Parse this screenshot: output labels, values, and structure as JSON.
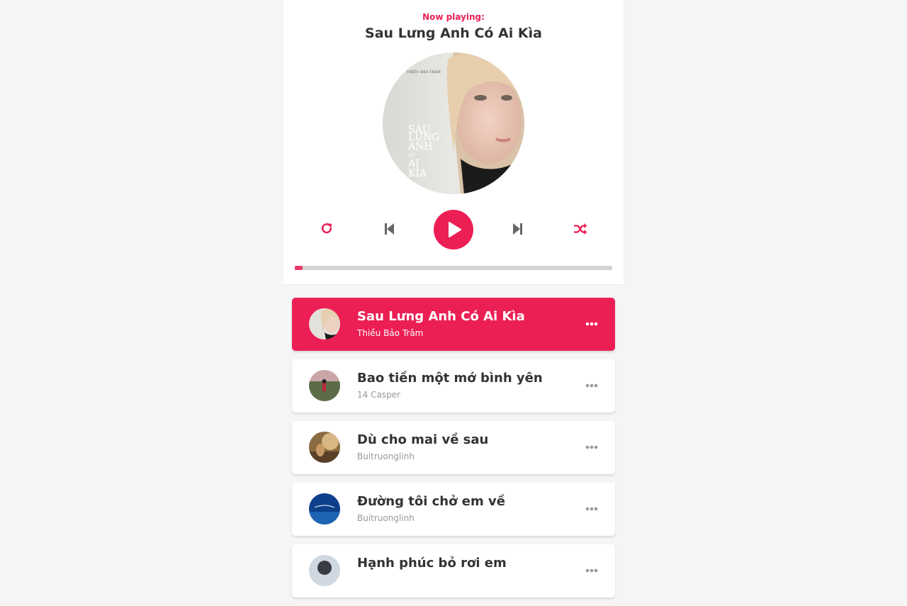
{
  "header": {
    "label": "Now playing:",
    "title": "Sau Lưng Anh Có Ai Kìa"
  },
  "cd": {
    "icon": "album-art-sau-lung-anh-co-ai-kia",
    "artist_small": "THIỀU BẢO TRÂM",
    "cover_lines": [
      "SAU",
      "LƯNG",
      "ANH",
      "có",
      "AI",
      "KÌA"
    ]
  },
  "controls": {
    "repeat_icon": "repeat-icon",
    "prev_icon": "step-backward-icon",
    "play_icon": "play-icon",
    "next_icon": "step-forward-icon",
    "random_icon": "shuffle-icon"
  },
  "progress": {
    "value_percent": 2.5
  },
  "colors": {
    "accent": "#ec1f55",
    "text": "#333333",
    "subtext": "#999999",
    "background": "#f5f5f5",
    "progress_track": "#d3d3d3"
  },
  "playlist": {
    "songs": [
      {
        "title": "Sau Lưng Anh Có Ai Kìa",
        "author": "Thiều Bảo Trâm",
        "active": true
      },
      {
        "title": "Bao tiền một mớ bình yên",
        "author": "14 Casper",
        "active": false
      },
      {
        "title": "Dù cho mai về sau",
        "author": "Buitruonglinh",
        "active": false
      },
      {
        "title": "Đường tôi chở em về",
        "author": "Buitruonglinh",
        "active": false
      },
      {
        "title": "Hạnh phúc bỏ rơi em",
        "author": "",
        "active": false
      }
    ],
    "option_icon": "ellipsis-icon"
  }
}
